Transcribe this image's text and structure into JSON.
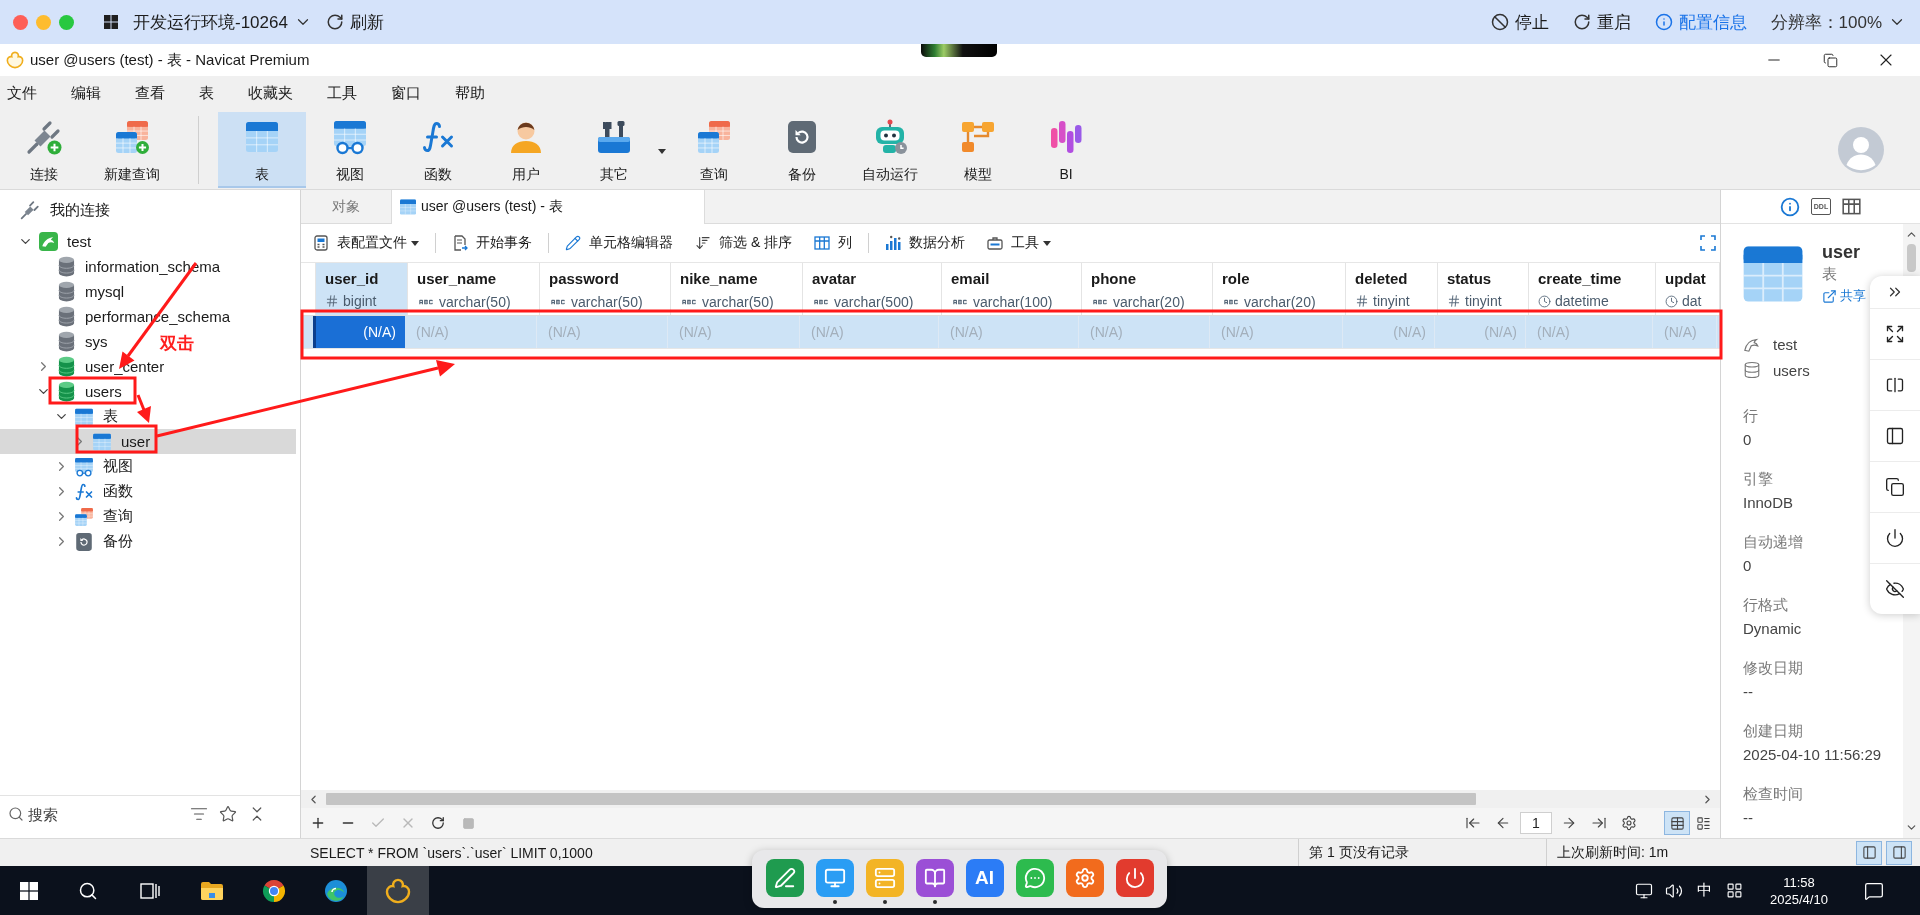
{
  "remote_bar": {
    "environment": "开发运行环境-10264",
    "refresh": "刷新",
    "stop": "停止",
    "restart": "重启",
    "config_info": "配置信息",
    "resolution": "分辨率：100%"
  },
  "window": {
    "title": "user @users (test) - 表 - Navicat Premium"
  },
  "menu": [
    "文件",
    "编辑",
    "查看",
    "表",
    "收藏夹",
    "工具",
    "窗口",
    "帮助"
  ],
  "toolbar": {
    "groups": [
      [
        {
          "label": "连接",
          "kind": "connect",
          "selected": false,
          "dropdown": false
        },
        {
          "label": "新建查询",
          "kind": "new_query",
          "selected": false,
          "dropdown": false
        }
      ],
      [
        {
          "label": "表",
          "kind": "table",
          "selected": true,
          "dropdown": false
        },
        {
          "label": "视图",
          "kind": "view",
          "selected": false,
          "dropdown": false
        },
        {
          "label": "函数",
          "kind": "function",
          "selected": false,
          "dropdown": false
        },
        {
          "label": "用户",
          "kind": "user",
          "selected": false,
          "dropdown": false
        },
        {
          "label": "其它",
          "kind": "other",
          "selected": false,
          "dropdown": true
        },
        {
          "label": "查询",
          "kind": "query",
          "selected": false,
          "dropdown": false
        },
        {
          "label": "备份",
          "kind": "backup",
          "selected": false,
          "dropdown": false
        },
        {
          "label": "自动运行",
          "kind": "automation",
          "selected": false,
          "dropdown": false
        },
        {
          "label": "模型",
          "kind": "model",
          "selected": false,
          "dropdown": false
        },
        {
          "label": "BI",
          "kind": "bi",
          "selected": false,
          "dropdown": false
        }
      ]
    ]
  },
  "sidebar": {
    "title": "我的连接",
    "tree": [
      {
        "label": "test",
        "kind": "connection",
        "expanded": true,
        "selected": false,
        "children": [
          {
            "label": "information_schema",
            "kind": "system_database",
            "selected": false
          },
          {
            "label": "mysql",
            "kind": "system_database",
            "selected": false
          },
          {
            "label": "performance_schema",
            "kind": "system_database",
            "selected": false
          },
          {
            "label": "sys",
            "kind": "system_database",
            "selected": false
          },
          {
            "label": "user_center",
            "kind": "database",
            "expanded": false,
            "selected": false
          },
          {
            "label": "users",
            "kind": "database",
            "expanded": true,
            "selected": false,
            "children": [
              {
                "label": "表",
                "kind": "tables",
                "expanded": true,
                "selected": false,
                "children": [
                  {
                    "label": "user",
                    "kind": "table",
                    "expanded": false,
                    "selected": true
                  }
                ]
              },
              {
                "label": "视图",
                "kind": "views",
                "expanded": false,
                "selected": false
              },
              {
                "label": "函数",
                "kind": "functions",
                "expanded": false,
                "selected": false
              },
              {
                "label": "查询",
                "kind": "queries",
                "expanded": false,
                "selected": false
              },
              {
                "label": "备份",
                "kind": "backups",
                "expanded": false,
                "selected": false
              }
            ]
          }
        ]
      }
    ],
    "search": {
      "placeholder": "搜索"
    }
  },
  "annotation": {
    "label": "双击"
  },
  "tabs": [
    {
      "label": "对象",
      "kind": "objects",
      "selected": false
    },
    {
      "label": "user @users (test) - 表",
      "kind": "table",
      "selected": true
    }
  ],
  "grid_toolbar": {
    "groups": [
      [
        {
          "label": "表配置文件",
          "kind": "profile",
          "dropdown": true
        }
      ],
      [
        {
          "label": "开始事务",
          "kind": "transaction",
          "dropdown": false
        }
      ],
      [
        {
          "label": "单元格编辑器",
          "kind": "cell_editor",
          "dropdown": false
        },
        {
          "label": "筛选 & 排序",
          "kind": "filter_sort",
          "dropdown": false
        },
        {
          "label": "列",
          "kind": "columns",
          "dropdown": false
        }
      ],
      [
        {
          "label": "数据分析",
          "kind": "analysis",
          "dropdown": false
        },
        {
          "label": "工具",
          "kind": "tools",
          "dropdown": true
        }
      ]
    ]
  },
  "table": {
    "columns": [
      {
        "name": "user_id",
        "type": "bigint",
        "kind": "number",
        "selected": true
      },
      {
        "name": "user_name",
        "type": "varchar(50)",
        "kind": "text",
        "selected": false
      },
      {
        "name": "password",
        "type": "varchar(50)",
        "kind": "text",
        "selected": false
      },
      {
        "name": "nike_name",
        "type": "varchar(50)",
        "kind": "text",
        "selected": false
      },
      {
        "name": "avatar",
        "type": "varchar(500)",
        "kind": "text",
        "selected": false
      },
      {
        "name": "email",
        "type": "varchar(100)",
        "kind": "text",
        "selected": false
      },
      {
        "name": "phone",
        "type": "varchar(20)",
        "kind": "text",
        "selected": false
      },
      {
        "name": "role",
        "type": "varchar(20)",
        "kind": "text",
        "selected": false
      },
      {
        "name": "deleted",
        "type": "tinyint",
        "kind": "number",
        "selected": false
      },
      {
        "name": "status",
        "type": "tinyint",
        "kind": "number",
        "selected": false
      },
      {
        "name": "create_time",
        "type": "datetime",
        "kind": "datetime",
        "selected": false
      },
      {
        "name": "updat",
        "type": "dat",
        "kind": "datetime",
        "selected": false
      }
    ],
    "rows": [
      {
        "selected": true,
        "cells": [
          {
            "text": "(N/A)",
            "selected": true
          },
          {
            "text": "(N/A)",
            "selected": false
          },
          {
            "text": "(N/A)",
            "selected": false
          },
          {
            "text": "(N/A)",
            "selected": false
          },
          {
            "text": "(N/A)",
            "selected": false
          },
          {
            "text": "(N/A)",
            "selected": false
          },
          {
            "text": "(N/A)",
            "selected": false
          },
          {
            "text": "(N/A)",
            "selected": false
          },
          {
            "text": "(N/A)",
            "selected": false
          },
          {
            "text": "(N/A)",
            "selected": false
          },
          {
            "text": "(N/A)",
            "selected": false
          },
          {
            "text": "(N/A)",
            "selected": false
          }
        ]
      }
    ]
  },
  "grid_footer": {
    "actions": [
      {
        "kind": "add",
        "disabled": false
      },
      {
        "kind": "remove",
        "disabled": false
      },
      {
        "kind": "apply",
        "disabled": true
      },
      {
        "kind": "discard",
        "disabled": true
      },
      {
        "kind": "refresh",
        "disabled": false
      },
      {
        "kind": "stop",
        "disabled": true
      }
    ],
    "page": "1",
    "views": [
      {
        "kind": "grid",
        "selected": true
      },
      {
        "kind": "form",
        "selected": false
      }
    ]
  },
  "info_panel": {
    "tabs": [
      {
        "kind": "info",
        "selected": true
      },
      {
        "kind": "ddl",
        "label": "DDL",
        "selected": false
      },
      {
        "kind": "columns",
        "selected": false
      }
    ],
    "name": "user",
    "type": "表",
    "share": "共享",
    "connection": "test",
    "database": "users",
    "properties": [
      {
        "label": "行",
        "value": "0"
      },
      {
        "label": "引擎",
        "value": "InnoDB"
      },
      {
        "label": "自动递增",
        "value": "0"
      },
      {
        "label": "行格式",
        "value": "Dynamic"
      },
      {
        "label": "修改日期",
        "value": "--"
      },
      {
        "label": "创建日期",
        "value": "2025-04-10 11:56:29"
      },
      {
        "label": "检查时间",
        "value": "--"
      }
    ]
  },
  "status_bar": {
    "sql": "SELECT * FROM `users`.`user` LIMIT 0,1000",
    "page_info": "第 1 页没有记录",
    "refresh_time": "上次刷新时间: 1m",
    "panels": [
      {
        "kind": "left",
        "selected": true
      },
      {
        "kind": "right",
        "selected": true
      }
    ]
  },
  "taskbar": {
    "apps": [
      {
        "kind": "explorer",
        "active": false
      },
      {
        "kind": "chrome",
        "active": false
      },
      {
        "kind": "edge",
        "active": false
      },
      {
        "kind": "navicat",
        "active": true
      }
    ],
    "dock": [
      {
        "kind": "sign",
        "running": false
      },
      {
        "kind": "monitor",
        "running": true
      },
      {
        "kind": "list",
        "running": true
      },
      {
        "kind": "book",
        "running": true
      },
      {
        "kind": "ai",
        "label": "AI",
        "running": false
      },
      {
        "kind": "chat",
        "running": false
      },
      {
        "kind": "gear",
        "running": false
      },
      {
        "kind": "power",
        "running": false
      }
    ],
    "ime": "中",
    "time": "11:58",
    "date": "2025/4/10"
  }
}
